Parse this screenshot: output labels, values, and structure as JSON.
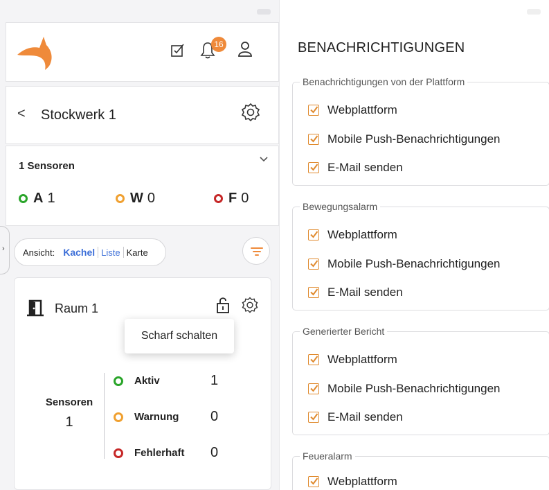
{
  "header": {
    "notification_count": "16"
  },
  "floor": {
    "back_symbol": "<",
    "title": "Stockwerk 1"
  },
  "sensors_panel": {
    "title": "1 Sensoren",
    "counters": [
      {
        "letter": "A",
        "count": "1",
        "color": "#2aa52a"
      },
      {
        "letter": "W",
        "count": "0",
        "color": "#f0a030"
      },
      {
        "letter": "F",
        "count": "0",
        "color": "#c62828"
      }
    ]
  },
  "view": {
    "label": "Ansicht:",
    "options": [
      "Kachel",
      "Liste",
      "Karte"
    ],
    "active": "Kachel"
  },
  "room": {
    "name": "Raum 1",
    "popup": "Scharf schalten",
    "sensors_label": "Sensoren",
    "sensors_count": "1",
    "status": [
      {
        "label": "Aktiv",
        "value": "1",
        "color": "#2aa52a"
      },
      {
        "label": "Warnung",
        "value": "0",
        "color": "#f0a030"
      },
      {
        "label": "Fehlerhaft",
        "value": "0",
        "color": "#c62828"
      }
    ]
  },
  "notifications": {
    "title": "BENACHRICHTIGUNGEN",
    "groups": [
      {
        "legend": "Benachrichtigungen von der Plattform",
        "options": [
          "Webplattform",
          "Mobile Push-Benachrichtigungen",
          "E-Mail senden"
        ]
      },
      {
        "legend": "Bewegungsalarm",
        "options": [
          "Webplattform",
          "Mobile Push-Benachrichtigungen",
          "E-Mail senden"
        ]
      },
      {
        "legend": "Generierter Bericht",
        "options": [
          "Webplattform",
          "Mobile Push-Benachrichtigungen",
          "E-Mail senden"
        ]
      },
      {
        "legend": "Feueralarm",
        "options": [
          "Webplattform"
        ]
      }
    ]
  },
  "colors": {
    "accent": "#ef8a3a",
    "link": "#3d6fd8"
  }
}
